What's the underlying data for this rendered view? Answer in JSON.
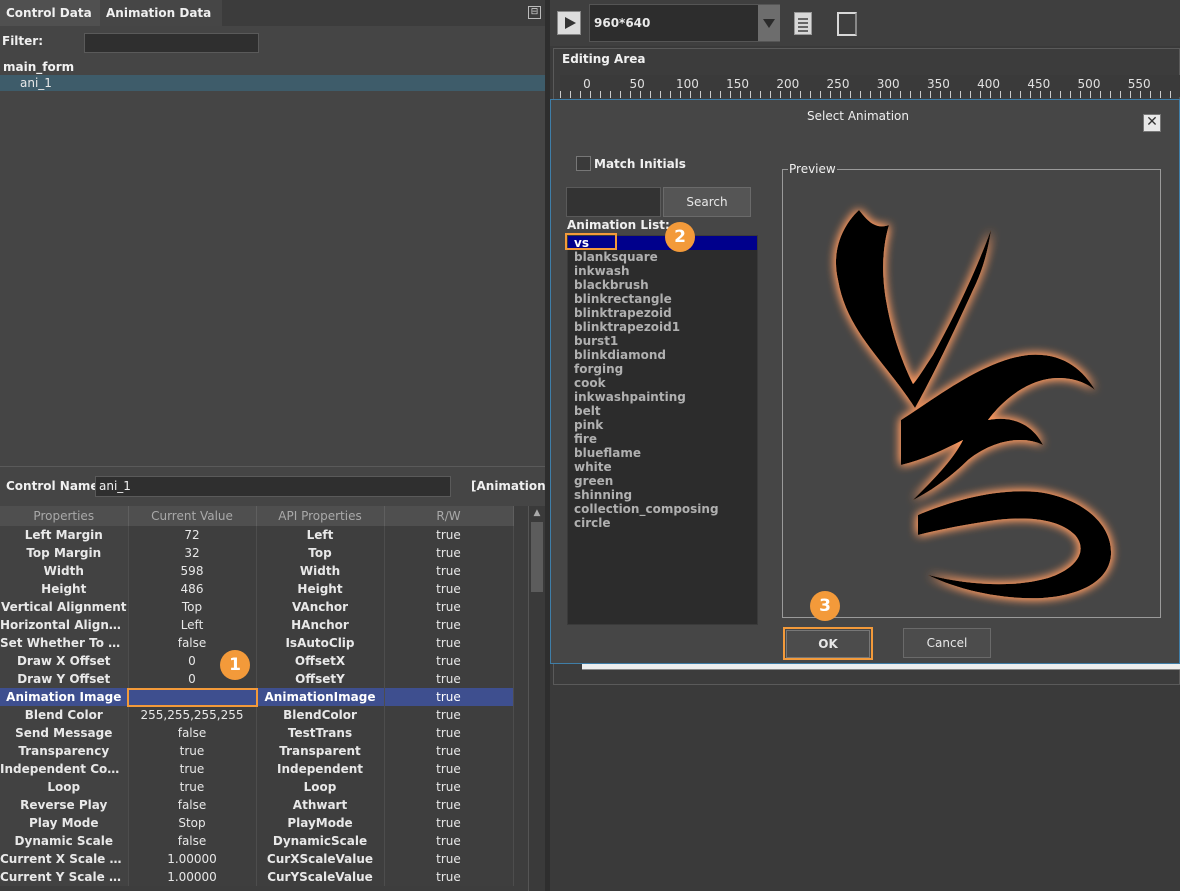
{
  "tabs": [
    "Control Data",
    "Animation Data"
  ],
  "filter": {
    "label": "Filter:",
    "value": ""
  },
  "tree": {
    "root": "main_form",
    "child": "ani_1"
  },
  "control": {
    "label": "Control Name:",
    "value": "ani_1",
    "type": "[Animation]"
  },
  "grid": {
    "headers": [
      "Properties",
      "Current Value",
      "API Properties",
      "R/W"
    ],
    "rows": [
      [
        "Left Margin",
        "72",
        "Left",
        "true"
      ],
      [
        "Top Margin",
        "32",
        "Top",
        "true"
      ],
      [
        "Width",
        "598",
        "Width",
        "true"
      ],
      [
        "Height",
        "486",
        "Height",
        "true"
      ],
      [
        "Vertical Alignment",
        "Top",
        "VAnchor",
        "true"
      ],
      [
        "Horizontal Alignment",
        "Left",
        "HAnchor",
        "true"
      ],
      [
        "Set Whether To Cli...",
        "false",
        "IsAutoClip",
        "true"
      ],
      [
        "Draw X Offset",
        "0",
        "OffsetX",
        "true"
      ],
      [
        "Draw Y Offset",
        "0",
        "OffsetY",
        "true"
      ],
      [
        "Animation Image",
        "",
        "AnimationImage",
        "true"
      ],
      [
        "Blend Color",
        "255,255,255,255",
        "BlendColor",
        "true"
      ],
      [
        "Send Message",
        "false",
        "TestTrans",
        "true"
      ],
      [
        "Transparency",
        "true",
        "Transparent",
        "true"
      ],
      [
        "Independent Contr...",
        "true",
        "Independent",
        "true"
      ],
      [
        "Loop",
        "true",
        "Loop",
        "true"
      ],
      [
        "Reverse Play",
        "false",
        "Athwart",
        "true"
      ],
      [
        "Play Mode",
        "Stop",
        "PlayMode",
        "true"
      ],
      [
        "Dynamic Scale",
        "false",
        "DynamicScale",
        "true"
      ],
      [
        "Current X Scale Value",
        "1.00000",
        "CurXScaleValue",
        "true"
      ],
      [
        "Current Y Scale Value",
        "1.00000",
        "CurYScaleValue",
        "true"
      ]
    ],
    "selected_row": 9
  },
  "toolbar": {
    "resolution": "960*640"
  },
  "editing_area": {
    "title": "Editing Area",
    "ruler": [
      "0",
      "50",
      "100",
      "150",
      "200",
      "250",
      "300",
      "350",
      "400",
      "450",
      "500",
      "550"
    ]
  },
  "dialog": {
    "title": "Select Animation",
    "match_initials": "Match Initials",
    "search_button": "Search",
    "list_label": "Animation List:",
    "items": [
      "vs",
      "blanksquare",
      "inkwash",
      "blackbrush",
      "blinkrectangle",
      "blinktrapezoid",
      "blinktrapezoid1",
      "burst1",
      "blinkdiamond",
      "forging",
      "cook",
      "inkwashpainting",
      "belt",
      "pink",
      "fire",
      "blueflame",
      "white",
      "green",
      "shinning",
      "collection_composing",
      "circle"
    ],
    "selected_item": 0,
    "preview_label": "Preview",
    "ok": "OK",
    "cancel": "Cancel"
  },
  "callouts": [
    "1",
    "2",
    "3"
  ],
  "colors": {
    "highlight": "#f39a3a",
    "selection": "#00008c",
    "row_selection": "#3e4f8f"
  }
}
